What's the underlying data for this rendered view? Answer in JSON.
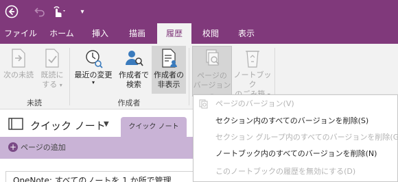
{
  "quick_access": {
    "back_icon": "back-arrow-icon",
    "undo_icon": "undo-icon",
    "touch_icon": "touch-mode-icon",
    "customize_glyph": "▾"
  },
  "tabs": [
    {
      "label": "ファイル"
    },
    {
      "label": "ホーム"
    },
    {
      "label": "挿入"
    },
    {
      "label": "描画"
    },
    {
      "label": "履歴"
    },
    {
      "label": "校閲"
    },
    {
      "label": "表示"
    }
  ],
  "ribbon": {
    "unread": {
      "next_unread": "次の未読",
      "mark_read_line1": "既読に",
      "mark_read_line2": "する",
      "group_label": "未読"
    },
    "authors": {
      "recent_changes": "最近の変更",
      "find_by_author_line1": "作成者で",
      "find_by_author_line2": "検索",
      "hide_authors_line1": "作成者の",
      "hide_authors_line2": "非表示",
      "group_label": "作成者"
    },
    "history": {
      "page_versions_line1": "ページの",
      "page_versions_line2": "バージョン",
      "recycle_bin_line1": "ノートブック",
      "recycle_bin_line2": "のごみ箱"
    },
    "caret": "▾"
  },
  "notebook": {
    "name": "クイック ノート",
    "dropdown": "▼",
    "section_tab": "クイック ノート",
    "add_page": "ページの追加",
    "page_title": "OneNote: すべてのノートを 1 か所で管理"
  },
  "menu": {
    "items": [
      {
        "label": "ページのバージョン(V)",
        "enabled": false
      },
      {
        "label": "セクション内のすべてのバージョンを削除(S)",
        "enabled": true
      },
      {
        "label": "セクション グループ内のすべてのバージョンを削除(G)",
        "enabled": false
      },
      {
        "label": "ノートブック内のすべてのバージョンを削除(N)",
        "enabled": true
      },
      {
        "label": "このノートブックの履歴を無効にする(D)",
        "enabled": false
      }
    ]
  },
  "colors": {
    "brand": "#80397b",
    "section": "#c9b3d6"
  }
}
